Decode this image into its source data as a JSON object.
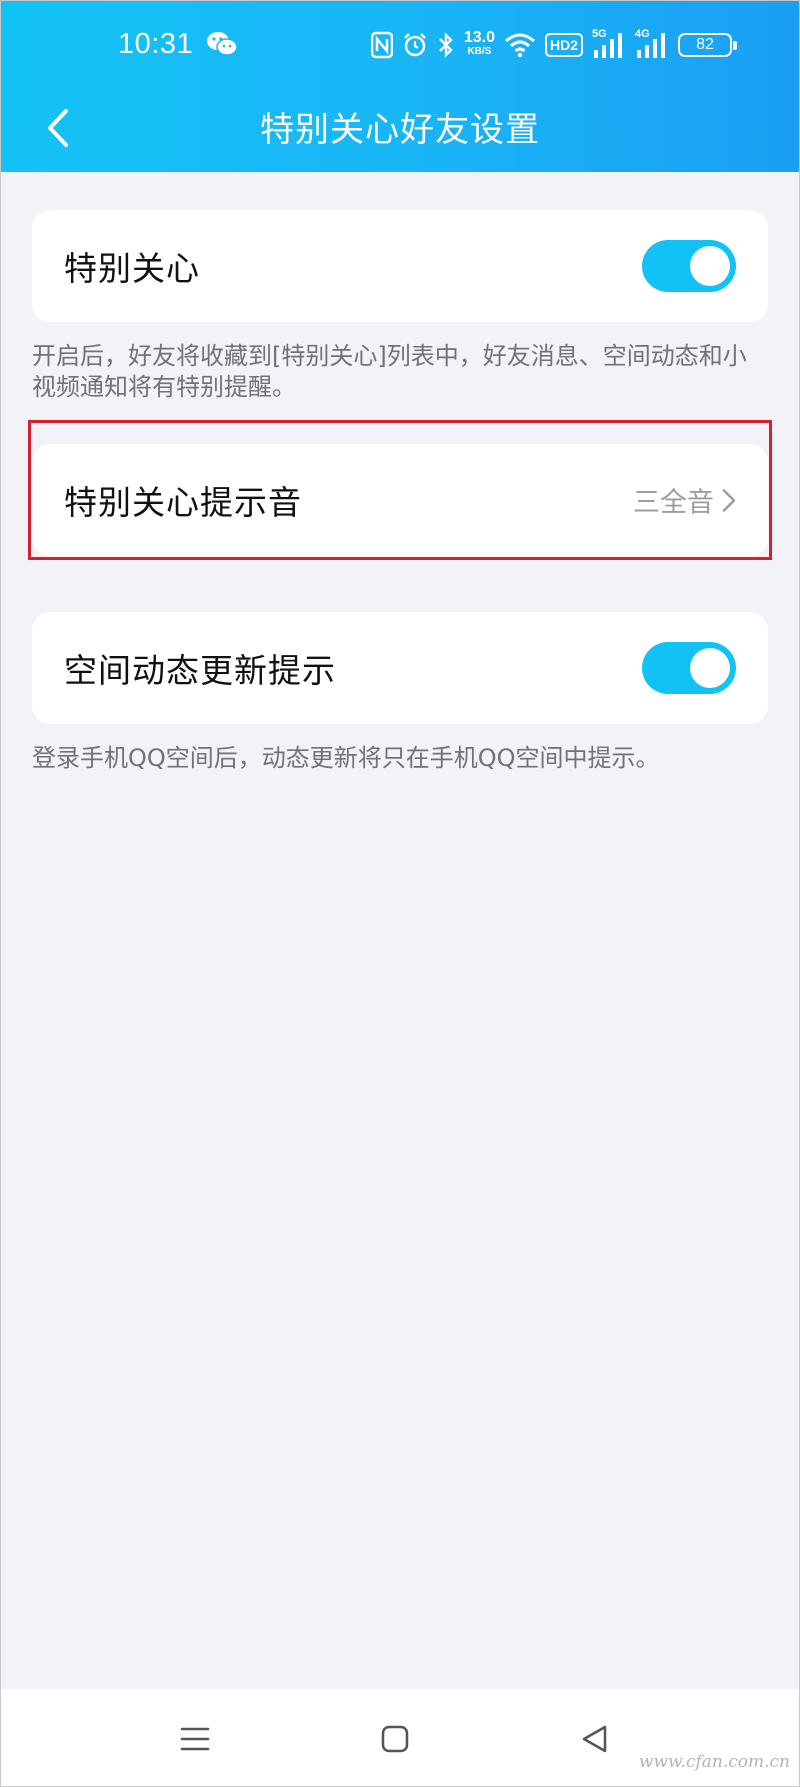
{
  "status_bar": {
    "time": "10:31",
    "net_speed_value": "13.0",
    "net_speed_unit": "KB/S",
    "hd_label": "HD2",
    "sim1_label": "5G",
    "sim2_label": "4G",
    "battery": "82"
  },
  "header": {
    "title": "特别关心好友设置"
  },
  "settings": {
    "special_care": {
      "label": "特别关心",
      "enabled": true,
      "hint": "开启后，好友将收藏到[特别关心]列表中，好友消息、空间动态和小视频通知将有特别提醒。"
    },
    "tone": {
      "label": "特别关心提示音",
      "value": "三全音"
    },
    "qzone_updates": {
      "label": "空间动态更新提示",
      "enabled": true,
      "hint": "登录手机QQ空间后，动态更新将只在手机QQ空间中提示。"
    }
  },
  "colors": {
    "header_gradient_start": "#13c3f5",
    "header_gradient_end": "#1a9ff3",
    "toggle_on": "#12c2f5",
    "page_background": "#f2f3f7",
    "highlight_border": "#d4202f"
  },
  "icons": {
    "back": "chevron-left-icon",
    "row_arrow": "chevron-right-icon",
    "menu": "menu-icon",
    "home": "home-square-icon",
    "back_system": "back-triangle-icon"
  },
  "watermark": "www.cfan.com.cn"
}
